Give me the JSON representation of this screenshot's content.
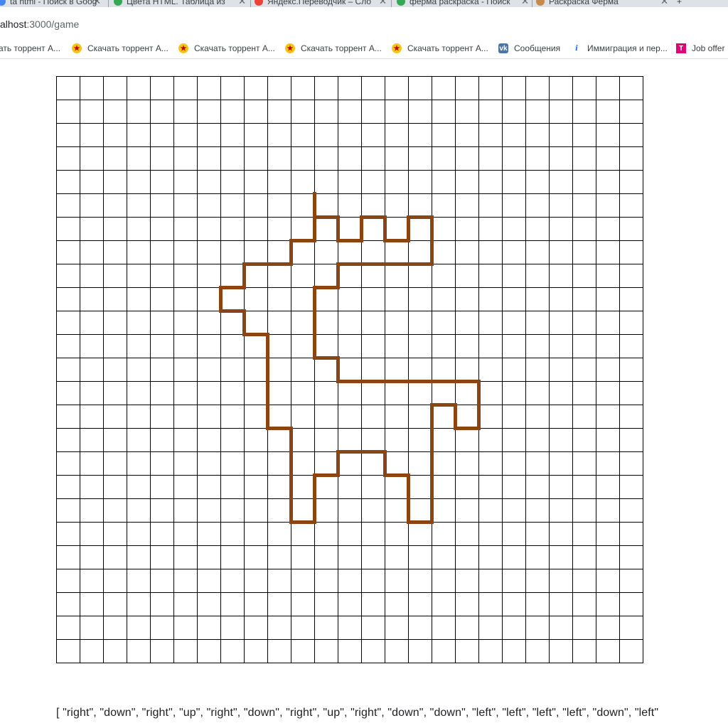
{
  "tabs": [
    {
      "title": "ta html - Поиск в Goog",
      "favicon_color": "#4285f4"
    },
    {
      "title": "Цвета HTML. Таблица из",
      "favicon_color": "#34a853"
    },
    {
      "title": "Яндекс.Переводчик – Сло",
      "favicon_color": "#ea4335"
    },
    {
      "title": "ферма раскраска - Поиск",
      "favicon_color": "#34a853"
    },
    {
      "title": "Раскраска Ферма",
      "favicon_color": "#c58b4a"
    }
  ],
  "tab_close_glyph": "✕",
  "new_tab_glyph": "+",
  "address": {
    "host": "alhost",
    "path": ":3000/game"
  },
  "bookmarks": [
    {
      "label": "ать торрент А...",
      "icon": "torrent-icon"
    },
    {
      "label": "Скачать торрент А...",
      "icon": "torrent-icon"
    },
    {
      "label": "Скачать торрент А...",
      "icon": "torrent-icon"
    },
    {
      "label": "Скачать торрент А...",
      "icon": "torrent-icon"
    },
    {
      "label": "Скачать торрент А...",
      "icon": "torrent-icon"
    },
    {
      "label": "Сообщения",
      "icon": "vk-icon"
    },
    {
      "label": "Иммиграция и пер...",
      "icon": "info-icon"
    },
    {
      "label": "Job offer",
      "icon": "tmobile-icon"
    }
  ],
  "grid": {
    "columns": 25,
    "rows": 25,
    "line_color": "#000000",
    "path_color": "#8b4513",
    "path_start": [
      11,
      6
    ],
    "path_moves": [
      "right",
      "down",
      "right",
      "up",
      "right",
      "down",
      "right",
      "up",
      "right",
      "down",
      "down",
      "left",
      "left",
      "left",
      "left",
      "down",
      "left",
      "down",
      "down",
      "down",
      "right",
      "down",
      "right",
      "right",
      "right",
      "right",
      "right",
      "right",
      "down",
      "down",
      "left",
      "up",
      "left",
      "down",
      "down",
      "down",
      "down",
      "down",
      "left",
      "up",
      "up",
      "left",
      "up",
      "left",
      "left",
      "down",
      "left",
      "down",
      "down",
      "left",
      "up",
      "up",
      "up",
      "up",
      "left",
      "up",
      "up",
      "up",
      "up",
      "left",
      "up",
      "left",
      "up",
      "right",
      "up",
      "right",
      "right",
      "up",
      "right",
      "up",
      "up"
    ]
  },
  "output_text": "[ \"right\", \"down\", \"right\", \"up\", \"right\", \"down\", \"right\", \"up\", \"right\", \"down\", \"down\", \"left\", \"left\", \"left\", \"left\", \"down\", \"left\""
}
